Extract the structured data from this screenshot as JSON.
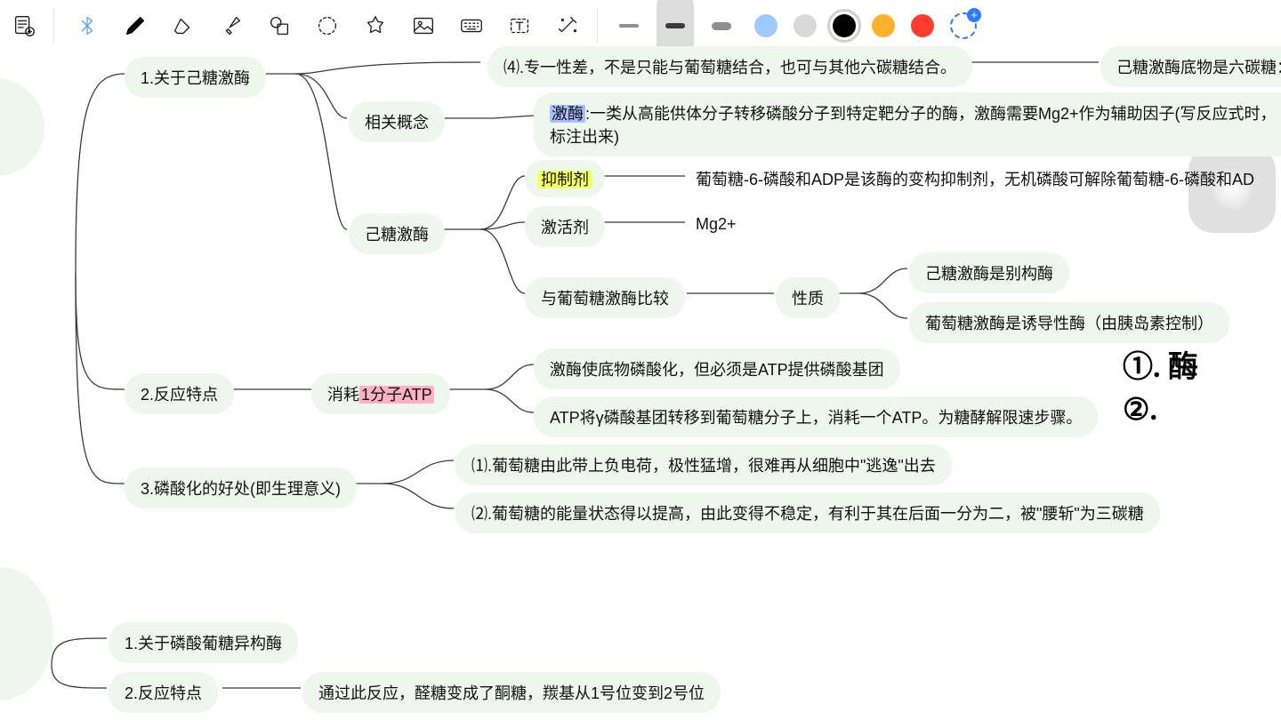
{
  "toolbar": {
    "icons": [
      "add-note-icon",
      "bluetooth-icon",
      "pen-icon",
      "eraser-icon",
      "highlighter-icon",
      "shapes-icon",
      "lasso-icon",
      "bookmark-icon",
      "image-icon",
      "keyboard-icon",
      "text-icon",
      "magic-icon"
    ],
    "stroke_widths": [
      "thin",
      "medium",
      "thick"
    ],
    "selected_stroke": "medium",
    "colors": [
      "light-blue",
      "light-grey",
      "black",
      "orange",
      "red",
      "add"
    ],
    "selected_color": "black"
  },
  "nodes": {
    "n1": "1.关于己糖激酶",
    "n4a": "⑷.专一性差，不是只能与葡萄糖结合，也可与其他六碳糖结合。",
    "n4b": "己糖激酶底物是六碳糖：",
    "relc": "相关概念",
    "relc_txt_pre": "激酶",
    "relc_txt": ":一类从高能供体分子转移磷酸分子到特定靶分子的酶，激酶需要Mg2+作为辅助因子(写反应式时，标注出来)",
    "hex": "己糖激酶",
    "inh": "抑制剂",
    "inh_txt": "葡萄糖-6-磷酸和ADP是该酶的变构抑制剂，无机磷酸可解除葡萄糖-6-磷酸和AD",
    "act": "激活剂",
    "act_txt": "Mg2+",
    "cmp": "与葡萄糖激酶比较",
    "prop": "性质",
    "prop1": "己糖激酶是别构酶",
    "prop2": "葡萄糖激酶是诱导性酶（由胰岛素控制）",
    "n2": "2.反应特点",
    "cons_pre": "消耗",
    "cons_hl": "1分子ATP",
    "cons1": "激酶使底物磷酸化，但必须是ATP提供磷酸基团",
    "cons2": "ATP将γ磷酸基团转移到葡萄糖分子上，消耗一个ATP。为糖酵解限速步骤。",
    "n3": "3.磷酸化的好处(即生理意义)",
    "n3a": "⑴.葡萄糖由此带上负电荷，极性猛增，很难再从细胞中\"逃逸\"出去",
    "n3b": "⑵.葡萄糖的能量状态得以提高，由此变得不稳定，有利于其在后面一分为二，被\"腰斩\"为三碳糖",
    "m1": "1.关于磷酸葡糖异构酶",
    "m2": "2.反应特点",
    "m2t": "通过此反应，醛糖变成了酮糖，羰基从1号位变到2号位",
    "hand1": "①. 酶",
    "hand2": "②."
  }
}
